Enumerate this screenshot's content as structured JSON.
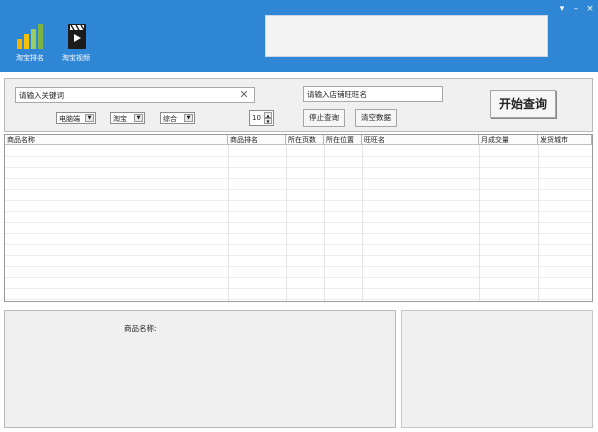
{
  "window": {
    "nav": [
      {
        "label": "淘宝排名",
        "icon": "bar-chart-icon"
      },
      {
        "label": "淘宝视频",
        "icon": "clapperboard-icon"
      }
    ],
    "controls": {
      "skin": "▾",
      "minimize": "–",
      "close": "×"
    }
  },
  "search": {
    "keyword_value": "请输入关键词",
    "clear_glyph": "✕",
    "shop_value": "请输入店铺旺旺名",
    "category": "电脑端",
    "platform": "淘宝",
    "sort": "综合",
    "pages": "10",
    "stop_label": "停止查询",
    "clear_label": "清空数据",
    "start_label": "开始查询"
  },
  "table": {
    "columns": [
      "商品名称",
      "商品排名",
      "所在页数",
      "所在位置",
      "旺旺名",
      "月成交量",
      "发货城市"
    ]
  },
  "detail": {
    "product_name_label": "商品名称:"
  }
}
